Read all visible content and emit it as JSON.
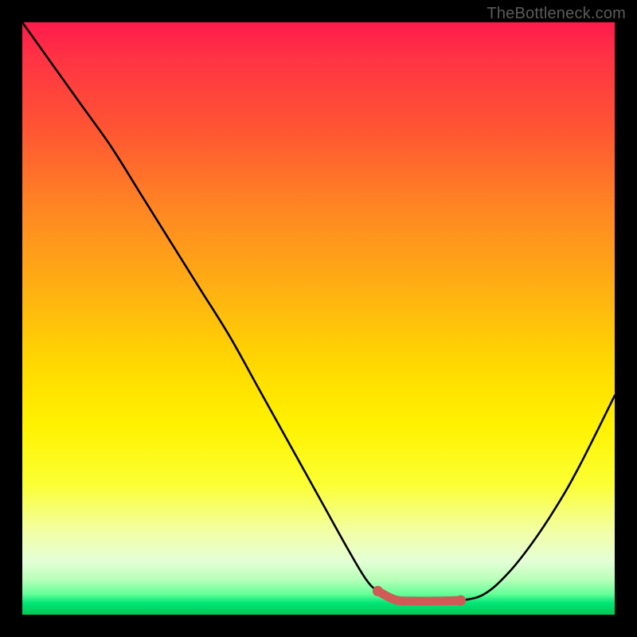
{
  "watermark": "TheBottleneck.com",
  "chart_data": {
    "type": "line",
    "title": "",
    "xlabel": "",
    "ylabel": "",
    "xlim": [
      0,
      100
    ],
    "ylim": [
      0,
      100
    ],
    "series": [
      {
        "name": "bottleneck-curve",
        "color": "#000000",
        "x": [
          0,
          5,
          10,
          15,
          20,
          25,
          30,
          35,
          40,
          45,
          50,
          55,
          58,
          60,
          63,
          66,
          70,
          74,
          78,
          82,
          86,
          90,
          94,
          100
        ],
        "y": [
          100,
          93,
          86,
          79,
          71,
          63,
          55,
          47,
          38,
          29,
          20,
          11,
          6,
          4,
          2.5,
          2.3,
          2.3,
          2.4,
          3.5,
          7,
          12,
          18,
          25,
          37
        ]
      },
      {
        "name": "optimal-zone",
        "color": "#d9534f",
        "x": [
          60,
          63,
          66,
          70,
          74
        ],
        "y": [
          4,
          2.5,
          2.3,
          2.3,
          2.4
        ]
      }
    ],
    "gradient_stops": [
      {
        "pos": 0,
        "color": "#ff1a4d"
      },
      {
        "pos": 50,
        "color": "#ffd900"
      },
      {
        "pos": 86,
        "color": "#f2ffa6"
      },
      {
        "pos": 100,
        "color": "#00c853"
      }
    ]
  }
}
